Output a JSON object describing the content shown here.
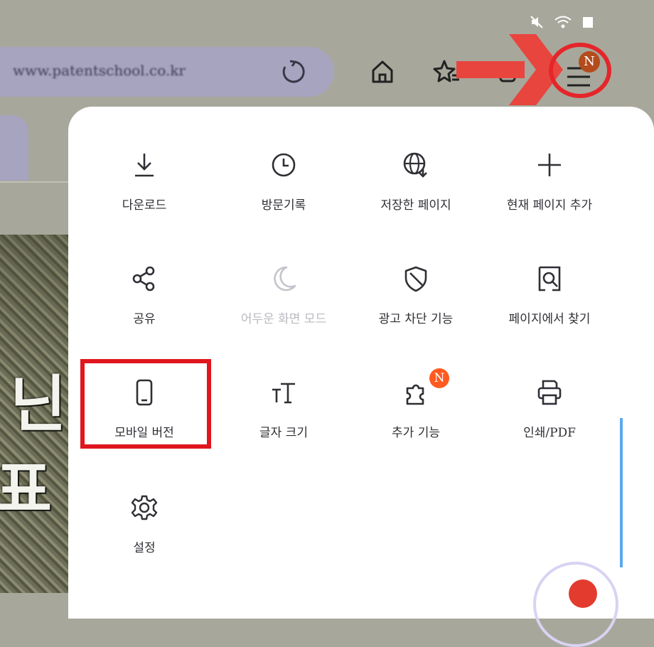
{
  "browser": {
    "url": "www.patentschool.co.kr",
    "menu_badge": "N"
  },
  "menu": {
    "items": [
      {
        "label": "다운로드",
        "icon": "download-icon"
      },
      {
        "label": "방문기록",
        "icon": "history-clock-icon"
      },
      {
        "label": "저장한 페이지",
        "icon": "saved-pages-globe-icon"
      },
      {
        "label": "현재 페이지 추가",
        "icon": "plus-icon"
      },
      {
        "label": "공유",
        "icon": "share-icon"
      },
      {
        "label": "어두운 화면 모드",
        "icon": "moon-icon",
        "disabled": true
      },
      {
        "label": "광고 차단 기능",
        "icon": "shield-icon"
      },
      {
        "label": "페이지에서 찾기",
        "icon": "find-in-page-icon"
      },
      {
        "label": "모바일 버전",
        "icon": "mobile-phone-icon"
      },
      {
        "label": "글자 크기",
        "icon": "text-size-icon"
      },
      {
        "label": "추가 기능",
        "icon": "puzzle-icon",
        "badge": "N"
      },
      {
        "label": "인쇄/PDF",
        "icon": "printer-icon"
      },
      {
        "label": "설정",
        "icon": "gear-icon"
      }
    ]
  },
  "background_art": {
    "glyphs": [
      "닌",
      "표"
    ]
  },
  "colors": {
    "accent_red": "#e4262a",
    "badge_orange": "#ff5a1f",
    "url_pill": "#a7a4c0"
  }
}
